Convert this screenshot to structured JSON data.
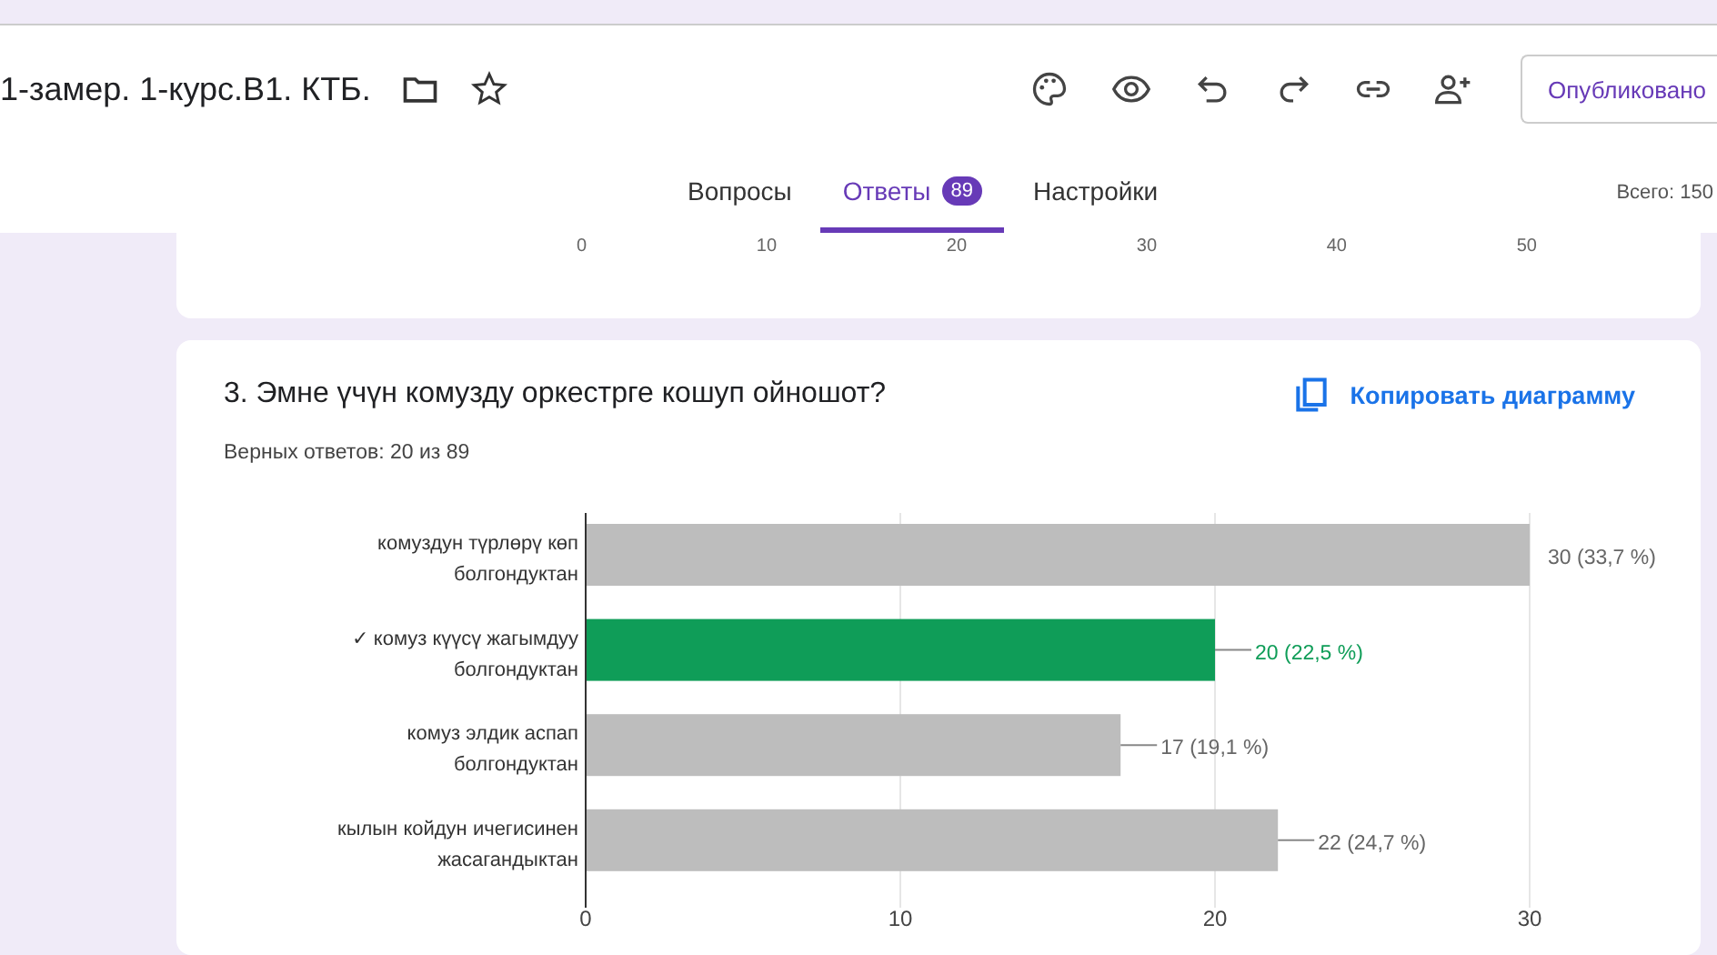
{
  "header": {
    "title": "1-замер. 1-курс.В1. КТБ.",
    "publish_button": "Опубликовано"
  },
  "tabs": [
    {
      "label": "Вопросы",
      "selected": false
    },
    {
      "label": "Ответы",
      "selected": true,
      "badge": "89"
    },
    {
      "label": "Настройки",
      "selected": false
    }
  ],
  "total": "Всего: 150",
  "previous_card": {
    "axis_ticks": [
      "0",
      "10",
      "20",
      "30",
      "40",
      "50"
    ]
  },
  "question": {
    "title": "3.  Эмне үчүн комузду оркестрге кошуп ойношот?",
    "copy_button": "Копировать диаграмму",
    "correct_count": "Верных ответов: 20 из 89",
    "chart_data": {
      "type": "bar",
      "orientation": "horizontal",
      "categories": [
        "комуздун түрлөрү көп\nболгондуктан",
        "✓ комуз күүсү жагымдуу\nболгондуктан",
        "комуз элдик аспап\nболгондуктан",
        "кылын койдун ичегисинен\nжасагандыктан"
      ],
      "series": [
        {
          "color": "#bdbdbd",
          "values": [
            30,
            null,
            17,
            22
          ]
        },
        {
          "color": "#0f9d58",
          "values": [
            null,
            20,
            null,
            null
          ]
        }
      ],
      "value_labels": [
        "30 (33,7 %)",
        "20 (22,5 %)",
        "17 (19,1 %)",
        "22 (24,7 %)"
      ],
      "xlim": [
        0,
        30
      ],
      "xticks": [
        0,
        10,
        20,
        30
      ]
    }
  }
}
